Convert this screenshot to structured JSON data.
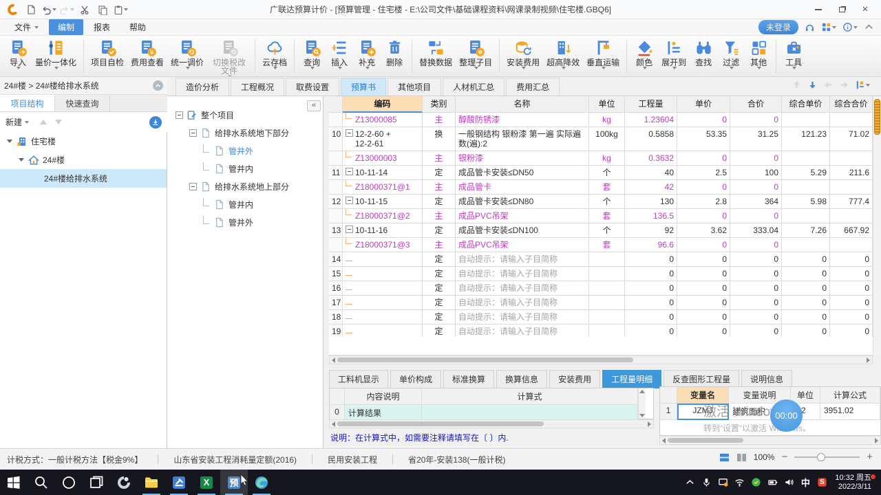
{
  "colors": {
    "accent_blue": "#4a89dc",
    "accent_orange": "#f6a623",
    "material_magenta": "#c03ac0",
    "active_tab_blue": "#3d97d9",
    "selection_blue": "#cde8f8",
    "header_peach": "#fbdeb6"
  },
  "window": {
    "title": "广联达预算计价 - [预算管理 - 住宅楼 - E:\\公司文件\\基础课程资料\\网课录制视频\\住宅楼.GBQ6]",
    "quick_icons": [
      {
        "icon": "new-doc-icon"
      },
      {
        "icon": "undo-icon",
        "dropdown": true
      },
      {
        "icon": "redo-icon",
        "dropdown": true,
        "disabled": true
      },
      {
        "icon": "cut-icon"
      },
      {
        "icon": "copy-icon"
      },
      {
        "icon": "paste-icon",
        "dropdown": true
      }
    ]
  },
  "menu_bar": {
    "items": [
      {
        "label": "文件",
        "dropdown": true
      },
      {
        "label": "编制",
        "active": true
      },
      {
        "label": "报表"
      },
      {
        "label": "帮助"
      }
    ],
    "right": {
      "login_label": "未登录",
      "icons": [
        {
          "icon": "headset-icon"
        },
        {
          "icon": "apps-grid-icon",
          "dropdown": true
        },
        {
          "icon": "info-icon",
          "dropdown": true
        },
        {
          "icon": "collapse-ribbon-icon"
        }
      ]
    }
  },
  "toolbar": {
    "groups": [
      [
        {
          "label": "导入",
          "icon": "import-icon",
          "dropdown": true
        },
        {
          "label": "量价一体化",
          "icon": "quantity-price-icon",
          "dropdown": true
        }
      ],
      [
        {
          "label": "项目自检",
          "icon": "project-check-icon"
        },
        {
          "label": "费用查看",
          "icon": "fee-view-icon"
        },
        {
          "label": "统一调价",
          "icon": "unified-price-icon",
          "dropdown": true
        },
        {
          "label": "切换税改文件",
          "icon": "switch-tax-file-icon",
          "dropdown": true,
          "disabled": true,
          "twoline": true
        }
      ],
      [
        {
          "label": "云存档",
          "icon": "cloud-archive-icon",
          "dropdown": true
        }
      ],
      [
        {
          "label": "查询",
          "icon": "query-icon",
          "dropdown": true
        },
        {
          "label": "插入",
          "icon": "insert-icon",
          "dropdown": true
        },
        {
          "label": "补充",
          "icon": "supplement-icon",
          "dropdown": true
        },
        {
          "label": "删除",
          "icon": "delete-icon"
        }
      ],
      [
        {
          "label": "替换数据",
          "icon": "replace-data-icon"
        },
        {
          "label": "整理子目",
          "icon": "organize-items-icon",
          "dropdown": true
        }
      ],
      [
        {
          "label": "安装费用",
          "icon": "install-fee-icon",
          "dropdown": true
        },
        {
          "label": "超高降效",
          "icon": "height-reduction-icon",
          "dropdown": true
        },
        {
          "label": "垂直运输",
          "icon": "vertical-transport-icon",
          "dropdown": true
        }
      ],
      [
        {
          "label": "颜色",
          "icon": "color-icon",
          "dropdown": true
        },
        {
          "label": "展开到",
          "icon": "expand-to-icon",
          "dropdown": true
        },
        {
          "label": "查找",
          "icon": "find-icon"
        },
        {
          "label": "过滤",
          "icon": "filter-icon",
          "dropdown": true
        },
        {
          "label": "其他",
          "icon": "other-icon",
          "dropdown": true
        }
      ],
      [
        {
          "label": "工具",
          "icon": "tools-icon",
          "dropdown": true
        }
      ]
    ]
  },
  "left_panel": {
    "breadcrumb": "24#楼 > 24#楼给排水系统",
    "tabs": [
      {
        "label": "项目结构",
        "active": true
      },
      {
        "label": "快速查询"
      }
    ],
    "new_button_label": "新建",
    "tree": [
      {
        "label": "住宅楼",
        "level": 0,
        "icon": "building-icon",
        "caret": true
      },
      {
        "label": "24#楼",
        "level": 1,
        "icon": "home-icon",
        "caret": true
      },
      {
        "label": "24#楼给排水系统",
        "level": 2,
        "selected": true
      }
    ]
  },
  "main_tabs": [
    {
      "label": "造价分析"
    },
    {
      "label": "工程概况"
    },
    {
      "label": "取费设置"
    },
    {
      "label": "预算书",
      "active": true
    },
    {
      "label": "其他项目"
    },
    {
      "label": "人材机汇总"
    },
    {
      "label": "费用汇总"
    }
  ],
  "table_nav": [
    {
      "icon": "row-up-icon",
      "disabled": true
    },
    {
      "icon": "row-down-icon"
    },
    {
      "icon": "row-left-icon",
      "disabled": true
    },
    {
      "icon": "row-right-icon",
      "disabled": true
    },
    {
      "icon": "locate-icon",
      "dropdown": true
    }
  ],
  "project_tree": [
    {
      "label": "整个项目",
      "level": 0,
      "box": true,
      "icon": "project-icon"
    },
    {
      "label": "给排水系统地下部分",
      "level": 1,
      "box": true,
      "icon": "document-icon"
    },
    {
      "label": "管井外",
      "level": 2,
      "icon": "document-icon",
      "selected": true
    },
    {
      "label": "管井内",
      "level": 2,
      "icon": "document-icon"
    },
    {
      "label": "给排水系统地上部分",
      "level": 1,
      "box": true,
      "icon": "document-icon"
    },
    {
      "label": "管井内",
      "level": 2,
      "icon": "document-icon"
    },
    {
      "label": "管井外",
      "level": 2,
      "icon": "document-icon"
    }
  ],
  "budget_table": {
    "columns": [
      "编码",
      "类别",
      "名称",
      "单位",
      "工程量",
      "单价",
      "合价",
      "综合单价",
      "综合合价"
    ],
    "rows": [
      {
        "num": "",
        "prefix": "branch",
        "code": "Z13000085",
        "cat": "主",
        "name": "醇酸防锈漆",
        "unit": "kg",
        "qty": "1.23604",
        "price": "0",
        "total": "0",
        "comp_price": "",
        "comp_total": "",
        "material": true
      },
      {
        "num": "10",
        "prefix": "minus",
        "code": "12-2-60 +\n12-2-61",
        "cat": "换",
        "name": "一般钢结构 银粉漆 第一遍  实际遍数(遍):2",
        "unit": "100kg",
        "qty": "0.5858",
        "price": "53.35",
        "total": "31.25",
        "comp_price": "121.23",
        "comp_total": "71.02",
        "tall": true
      },
      {
        "num": "",
        "prefix": "branch",
        "code": "Z13000003",
        "cat": "主",
        "name": "银粉漆",
        "unit": "kg",
        "qty": "0.3632",
        "price": "0",
        "total": "0",
        "comp_price": "",
        "comp_total": "",
        "material": true
      },
      {
        "num": "11",
        "prefix": "minus",
        "code": "10-11-14",
        "cat": "定",
        "name": "成品管卡安装≤DN50",
        "unit": "个",
        "qty": "40",
        "price": "2.5",
        "total": "100",
        "comp_price": "5.29",
        "comp_total": "211.6"
      },
      {
        "num": "",
        "prefix": "branch",
        "code": "Z18000371@1",
        "cat": "主",
        "name": "成品管卡",
        "unit": "套",
        "qty": "42",
        "price": "0",
        "total": "0",
        "comp_price": "",
        "comp_total": "",
        "material": true
      },
      {
        "num": "12",
        "prefix": "minus",
        "code": "10-11-15",
        "cat": "定",
        "name": "成品管卡安装≤DN80",
        "unit": "个",
        "qty": "130",
        "price": "2.8",
        "total": "364",
        "comp_price": "5.98",
        "comp_total": "777.4"
      },
      {
        "num": "",
        "prefix": "branch",
        "code": "Z18000371@2",
        "cat": "主",
        "name": "成品PVC吊架",
        "unit": "套",
        "qty": "136.5",
        "price": "0",
        "total": "0",
        "comp_price": "",
        "comp_total": "",
        "material": true
      },
      {
        "num": "13",
        "prefix": "minus",
        "code": "10-11-16",
        "cat": "定",
        "name": "成品管卡安装≤DN100",
        "unit": "个",
        "qty": "92",
        "price": "3.62",
        "total": "333.04",
        "comp_price": "7.26",
        "comp_total": "667.92"
      },
      {
        "num": "",
        "prefix": "branch",
        "code": "Z18000371@3",
        "cat": "主",
        "name": "成品PVC吊架",
        "unit": "套",
        "qty": "96.6",
        "price": "0",
        "total": "0",
        "comp_price": "",
        "comp_total": "",
        "material": true
      },
      {
        "num": "14",
        "prefix": "dash",
        "code": "",
        "cat": "定",
        "name": "自动提示：请输入子目简称",
        "unit": "",
        "qty": "0",
        "price": "0",
        "total": "0",
        "comp_price": "0",
        "comp_total": "0",
        "placeholder": true
      },
      {
        "num": "15",
        "prefix": "dash",
        "code": "",
        "cat": "定",
        "name": "自动提示：请输入子目简称",
        "unit": "",
        "qty": "0",
        "price": "0",
        "total": "0",
        "comp_price": "0",
        "comp_total": "0",
        "placeholder": true
      },
      {
        "num": "16",
        "prefix": "dash",
        "code": "",
        "cat": "定",
        "name": "自动提示：请输入子目简称",
        "unit": "",
        "qty": "0",
        "price": "0",
        "total": "0",
        "comp_price": "0",
        "comp_total": "0",
        "placeholder": true
      },
      {
        "num": "17",
        "prefix": "dash",
        "code": "",
        "cat": "定",
        "name": "自动提示：请输入子目简称",
        "unit": "",
        "qty": "0",
        "price": "0",
        "total": "0",
        "comp_price": "0",
        "comp_total": "0",
        "placeholder": true
      },
      {
        "num": "18",
        "prefix": "dash",
        "code": "",
        "cat": "定",
        "name": "自动提示：请输入子目简称",
        "unit": "",
        "qty": "0",
        "price": "0",
        "total": "0",
        "comp_price": "0",
        "comp_total": "0",
        "placeholder": true
      },
      {
        "num": "19",
        "prefix": "dash",
        "code": "",
        "cat": "定",
        "name": "自动提示：请输入子目简称",
        "unit": "",
        "qty": "0",
        "price": "0",
        "total": "0",
        "comp_price": "0",
        "comp_total": "0",
        "placeholder": true
      }
    ]
  },
  "bottom_tabs": [
    {
      "label": "工料机显示"
    },
    {
      "label": "单价构成"
    },
    {
      "label": "标准换算"
    },
    {
      "label": "换算信息"
    },
    {
      "label": "安装费用"
    },
    {
      "label": "工程量明细",
      "active": true
    },
    {
      "label": "反查图形工程量"
    },
    {
      "label": "说明信息"
    }
  ],
  "calc_panel": {
    "columns": [
      "内容说明",
      "计算式"
    ],
    "rows": [
      {
        "num": "0",
        "desc": "计算结果",
        "formula": ""
      }
    ],
    "note": "说明：在计算式中，如需要注释请填写在〔 〕内."
  },
  "variables_panel": {
    "columns": [
      "变量名",
      "变量说明",
      "单位",
      "计算公式"
    ],
    "rows": [
      {
        "num": "1",
        "name": "JZMJ",
        "desc": "建筑面积",
        "unit": "m2",
        "formula": "3951.02",
        "selected": true
      }
    ]
  },
  "status_bar": {
    "items": [
      "计税方式：一般计税方法【税金9%】",
      "山东省安装工程消耗量定额(2016)",
      "民用安装工程",
      "省20年-安装138(一般计税)"
    ],
    "zoom_level": "100%"
  },
  "overlay": {
    "watermark_line1": "激活 Windows",
    "watermark_line2": "转到“设置”以激活 Windows。",
    "recording_timer": "00:00"
  },
  "taskbar": {
    "apps": [
      {
        "icon": "start-icon"
      },
      {
        "icon": "taskbar-search-icon"
      },
      {
        "icon": "cortana-icon"
      },
      {
        "icon": "task-view-icon"
      },
      {
        "icon": "glodon-launcher-icon"
      },
      {
        "icon": "file-explorer-icon",
        "open": true
      },
      {
        "icon": "gtj-app-icon",
        "open": true
      },
      {
        "icon": "excel-icon",
        "glyph": "X",
        "open": true
      },
      {
        "icon": "budget-app-icon",
        "glyph": "预",
        "open": true,
        "active": true
      },
      {
        "icon": "edge-icon",
        "open": true
      }
    ],
    "tray": [
      {
        "icon": "tray-expand-icon"
      },
      {
        "icon": "microphone-icon"
      },
      {
        "icon": "screen-share-icon"
      },
      {
        "icon": "wifi-icon"
      },
      {
        "icon": "antivirus-icon"
      },
      {
        "icon": "battery-icon"
      },
      {
        "icon": "volume-icon"
      },
      {
        "icon": "ime-icon",
        "glyph": "中"
      },
      {
        "icon": "sogou-icon",
        "glyph": "S"
      }
    ],
    "clock": {
      "time": "10:32 周五",
      "date": "2022/3/11"
    }
  }
}
